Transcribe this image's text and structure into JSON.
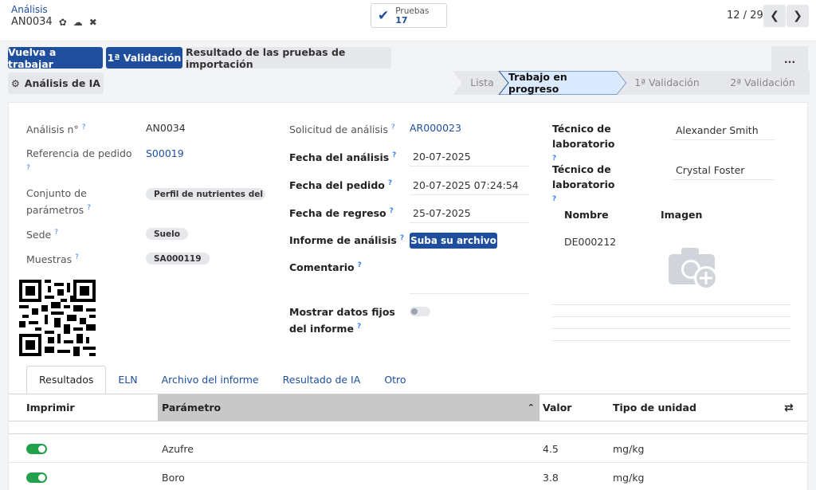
{
  "breadcrumb": {
    "app": "Análisis",
    "record": "AN0034"
  },
  "header_icons": {
    "settings": "gear-icon",
    "save": "cloud-upload-icon",
    "discard": "close-icon"
  },
  "smart_button": {
    "label": "Pruebas",
    "count": "17"
  },
  "pager": {
    "text": "12 / 29"
  },
  "actions": {
    "rework": "Vuelva a trabajar",
    "first_validation": "1ª Validación",
    "import_results": "Resultado de las pruebas de importación",
    "ai_analysis": "Análisis de IA",
    "more": "..."
  },
  "statusbar": {
    "stages": [
      "Lista",
      "Trabajo en progreso",
      "1ª Validación",
      "2ª Validación"
    ],
    "active": "Trabajo en progreso"
  },
  "form": {
    "left": {
      "analysis_no_label": "Análisis n°",
      "analysis_no": "AN0034",
      "order_ref_label": "Referencia de pedido",
      "order_ref": "S00019",
      "param_set_label": "Conjunto de parámetros",
      "param_set": "Perfil de nutrientes del ...",
      "site_label": "Sede",
      "site": "Suelo",
      "samples_label": "Muestras",
      "samples": "SA000119"
    },
    "middle": {
      "request_label": "Solicitud de análisis",
      "request": "AR000023",
      "analysis_date_label": "Fecha del análisis",
      "analysis_date": "20-07-2025",
      "order_date_label": "Fecha del pedido",
      "order_date": "20-07-2025 07:24:54",
      "return_date_label": "Fecha de regreso",
      "return_date": "25-07-2025",
      "report_label": "Informe de análisis",
      "upload_label": "Suba su archivo",
      "comment_label": "Comentario",
      "fixed_data_label": "Mostrar datos fijos del informe"
    },
    "right": {
      "tech1_label": "Técnico de laboratorio",
      "tech1": "Alexander Smith",
      "tech2_label": "Técnico de laboratorio",
      "tech2": "Crystal Foster",
      "col_name": "Nombre",
      "col_image": "Imagen",
      "device": "DE000212"
    },
    "help_mark": "?"
  },
  "tabs": [
    "Resultados",
    "ELN",
    "Archivo del informe",
    "Resultado de IA",
    "Otro"
  ],
  "table": {
    "columns": [
      "Imprimir",
      "Parámetro",
      "Valor",
      "Tipo de unidad"
    ],
    "rows": [
      {
        "print": true,
        "parameter": "Azufre",
        "value": "4.5",
        "unit": "mg/kg"
      },
      {
        "print": true,
        "parameter": "Boro",
        "value": "3.8",
        "unit": "mg/kg"
      }
    ]
  },
  "colors": {
    "primary": "#1f4e9c",
    "toggle_on": "#22a04b",
    "help": "#3b82f6"
  }
}
